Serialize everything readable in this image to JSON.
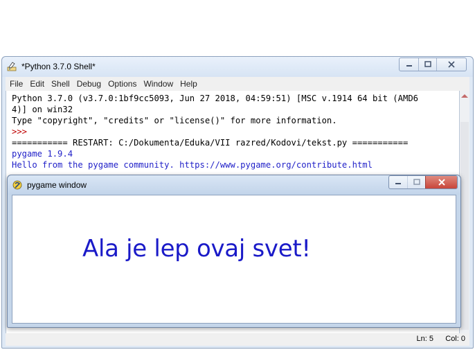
{
  "shell": {
    "title": "*Python 3.7.0 Shell*",
    "menu": [
      "File",
      "Edit",
      "Shell",
      "Debug",
      "Options",
      "Window",
      "Help"
    ],
    "lines": [
      {
        "text": "Python 3.7.0 (v3.7.0:1bf9cc5093, Jun 27 2018, 04:59:51) [MSC v.1914 64 bit (AMD6",
        "color": "#000000"
      },
      {
        "text": "4)] on win32",
        "color": "#000000"
      },
      {
        "text": "Type \"copyright\", \"credits\" or \"license()\" for more information.",
        "color": "#000000"
      },
      {
        "text": ">>>",
        "color": "#c00000"
      },
      {
        "text": "=========== RESTART: C:/Dokumenta/Eduka/VII razred/Kodovi/tekst.py ===========",
        "color": "#000000"
      },
      {
        "text": "pygame 1.9.4",
        "color": "#1f1fc8"
      },
      {
        "text": "Hello from the pygame community. https://www.pygame.org/contribute.html",
        "color": "#1f1fc8"
      }
    ],
    "status": {
      "line": "Ln: 5",
      "col": "Col: 0"
    }
  },
  "pygame_window": {
    "title": "pygame window",
    "message": "Ala je lep ovaj svet!",
    "message_color": "#1a1ac8"
  },
  "icons": {
    "shell_icon": "idle-python-icon",
    "pygame_icon": "pygame-snake-icon",
    "minimize": "minimize-icon",
    "maximize": "maximize-icon",
    "close": "close-icon"
  },
  "colors": {
    "close_button_red": "#c8453a",
    "titlebar": "#dfe9f5"
  }
}
